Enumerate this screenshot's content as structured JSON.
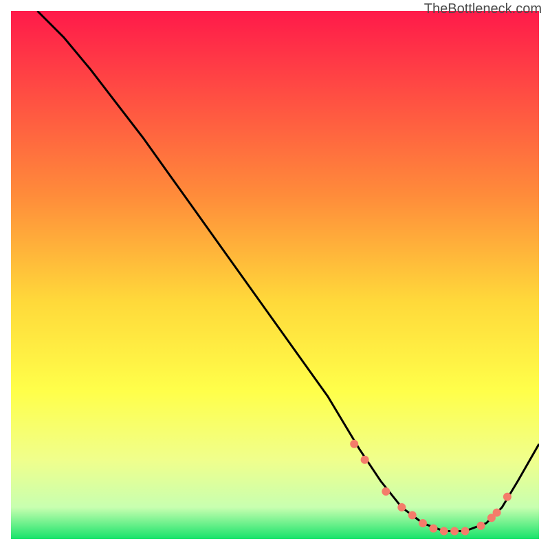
{
  "watermark": "TheBottleneck.com",
  "chart_data": {
    "type": "line",
    "title": "",
    "xlabel": "",
    "ylabel": "",
    "xlim": [
      0,
      100
    ],
    "ylim": [
      0,
      100
    ],
    "grid": false,
    "legend": false,
    "gradient_stops": [
      {
        "offset": 0,
        "color": "#ff1a4a"
      },
      {
        "offset": 35,
        "color": "#ff8c3a"
      },
      {
        "offset": 55,
        "color": "#ffd93a"
      },
      {
        "offset": 72,
        "color": "#ffff4a"
      },
      {
        "offset": 85,
        "color": "#f0ff8c"
      },
      {
        "offset": 94,
        "color": "#c8ffb0"
      },
      {
        "offset": 100,
        "color": "#17e36a"
      }
    ],
    "series": [
      {
        "name": "bottleneck-curve",
        "color": "#000000",
        "x": [
          5,
          10,
          15,
          20,
          25,
          30,
          35,
          40,
          45,
          50,
          55,
          60,
          63,
          66,
          70,
          74,
          78,
          82,
          86,
          90,
          93,
          96,
          100
        ],
        "y": [
          100,
          95,
          89,
          82.5,
          76,
          69,
          62,
          55,
          48,
          41,
          34,
          27,
          22,
          17,
          11,
          6,
          3,
          1.5,
          1.5,
          3,
          6,
          11,
          18
        ]
      }
    ],
    "markers": {
      "name": "highlight-points",
      "color": "#f47c6a",
      "radius": 6,
      "points": [
        {
          "x": 65,
          "y": 18
        },
        {
          "x": 67,
          "y": 15
        },
        {
          "x": 71,
          "y": 9
        },
        {
          "x": 74,
          "y": 6
        },
        {
          "x": 76,
          "y": 4.5
        },
        {
          "x": 78,
          "y": 3
        },
        {
          "x": 80,
          "y": 2
        },
        {
          "x": 82,
          "y": 1.5
        },
        {
          "x": 84,
          "y": 1.5
        },
        {
          "x": 86,
          "y": 1.5
        },
        {
          "x": 89,
          "y": 2.5
        },
        {
          "x": 91,
          "y": 4
        },
        {
          "x": 92,
          "y": 5
        },
        {
          "x": 94,
          "y": 8
        }
      ]
    }
  }
}
